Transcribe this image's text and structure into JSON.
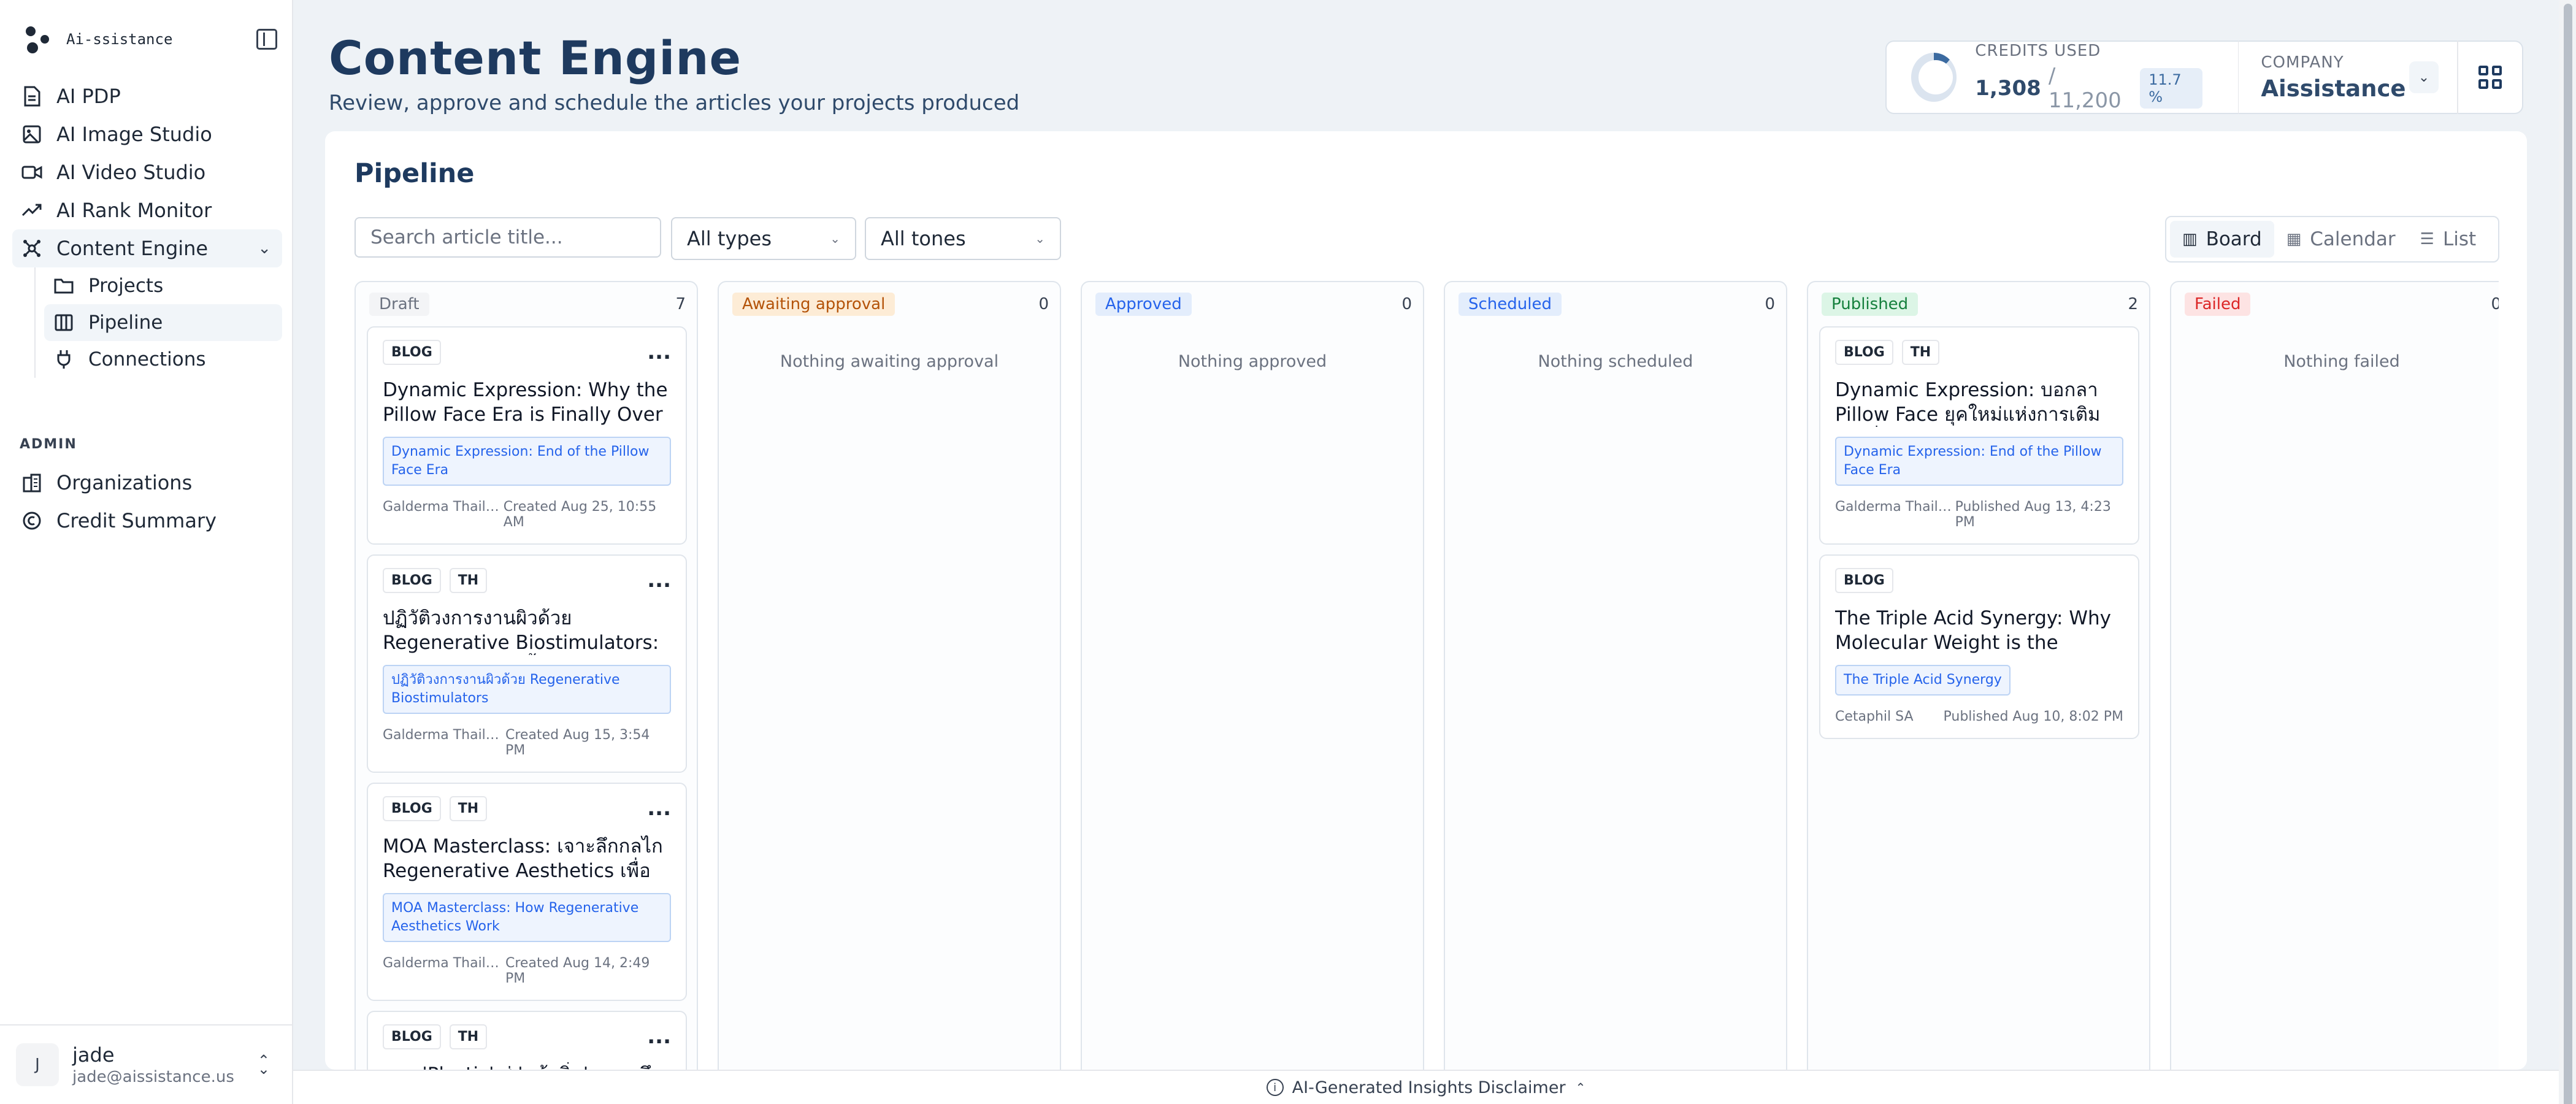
{
  "sidebar": {
    "brand": "Ai-ssistance",
    "nav": [
      {
        "label": "AI PDP",
        "icon": "document-icon"
      },
      {
        "label": "AI Image Studio",
        "icon": "image-icon"
      },
      {
        "label": "AI Video Studio",
        "icon": "video-icon"
      },
      {
        "label": "AI Rank Monitor",
        "icon": "trend-icon"
      },
      {
        "label": "Content Engine",
        "icon": "network-icon"
      }
    ],
    "sub": [
      {
        "label": "Projects",
        "icon": "folder-icon"
      },
      {
        "label": "Pipeline",
        "icon": "columns-icon"
      },
      {
        "label": "Connections",
        "icon": "plug-icon"
      }
    ],
    "admin_label": "ADMIN",
    "admin": [
      {
        "label": "Organizations",
        "icon": "building-icon"
      },
      {
        "label": "Credit Summary",
        "icon": "coin-icon"
      }
    ],
    "user": {
      "initial": "J",
      "name": "jade",
      "email": "jade@aissistance.us"
    }
  },
  "header": {
    "title": "Content Engine",
    "subtitle": "Review, approve and schedule the articles your projects produced",
    "credits_label": "CREDITS USED",
    "credits_used": "1,308",
    "credits_total": "/ 11,200",
    "credits_pct": "11.7 %",
    "credits_fraction": 0.117,
    "company_label": "COMPANY",
    "company_name": "Aissistance"
  },
  "pipeline": {
    "title": "Pipeline",
    "search_placeholder": "Search article title...",
    "type_filter": "All types",
    "tone_filter": "All tones",
    "views": [
      "Board",
      "Calendar",
      "List"
    ],
    "active_view": "Board"
  },
  "columns": [
    {
      "name": "Draft",
      "count": "7",
      "pill_bg": "#f3f4f6",
      "pill_fg": "#6b7280",
      "empty": "",
      "cards": [
        {
          "tags": [
            "BLOG"
          ],
          "title": "Dynamic Expression: Why the Pillow Face Era is Finally Over",
          "project": "Dynamic Expression: End of the Pillow Face Era",
          "org": "Galderma Thailand",
          "date": "Created Aug 25, 10:55 AM"
        },
        {
          "tags": [
            "BLOG",
            "TH"
          ],
          "title": "ปฏิวัติวงการงานผิวด้วย Regenerative Biostimulators: เจาะลึกนวัตกรรมฟื้นฟูผิว",
          "project": "ปฏิวัติวงการงานผิวด้วย Regenerative Biostimulators",
          "org": "Galderma Thailand",
          "date": "Created Aug 15, 3:54 PM"
        },
        {
          "tags": [
            "BLOG",
            "TH"
          ],
          "title": "MOA Masterclass: เจาะลึกกลไก Regenerative Aesthetics เพื่อผิวสุขภาพดี",
          "project": "MOA Masterclass: How Regenerative Aesthetics Work",
          "org": "Galderma Thailand",
          "date": "Created Aug 14, 2:49 PM"
        },
        {
          "tags": [
            "BLOG",
            "TH"
          ],
          "title": "จาก 'Plastic' สู่ 'หน้าอิ่ม': เจาะลึกเทรนด์",
          "project": "",
          "org": "",
          "date": ""
        }
      ]
    },
    {
      "name": "Awaiting approval",
      "count": "0",
      "pill_bg": "#fdecd6",
      "pill_fg": "#b45309",
      "empty": "Nothing awaiting approval",
      "cards": []
    },
    {
      "name": "Approved",
      "count": "0",
      "pill_bg": "#e3edfc",
      "pill_fg": "#2563eb",
      "empty": "Nothing approved",
      "cards": []
    },
    {
      "name": "Scheduled",
      "count": "0",
      "pill_bg": "#e3edfc",
      "pill_fg": "#2563eb",
      "empty": "Nothing scheduled",
      "cards": []
    },
    {
      "name": "Published",
      "count": "2",
      "pill_bg": "#dcf5e6",
      "pill_fg": "#15803d",
      "empty": "",
      "cards": [
        {
          "tags": [
            "BLOG",
            "TH"
          ],
          "title": "Dynamic Expression: บอกลา Pillow Face ยุคใหม่แห่งการเติมเต็มที่เป็นธรรมชาติ",
          "project": "Dynamic Expression: End of the Pillow Face Era",
          "org": "Galderma Thailand",
          "date": "Published Aug 13, 4:23 PM"
        },
        {
          "tags": [
            "BLOG"
          ],
          "title": "The Triple Acid Synergy: Why Molecular Weight is the Secret to Hydration",
          "project": "The Triple Acid Synergy",
          "org": "Cetaphil SA",
          "date": "Published Aug 10, 8:02 PM"
        }
      ]
    },
    {
      "name": "Failed",
      "count": "0",
      "pill_bg": "#fde3e3",
      "pill_fg": "#dc2626",
      "empty": "Nothing failed",
      "cards": []
    }
  ],
  "footer": {
    "disclaimer": "AI-Generated Insights Disclaimer"
  }
}
